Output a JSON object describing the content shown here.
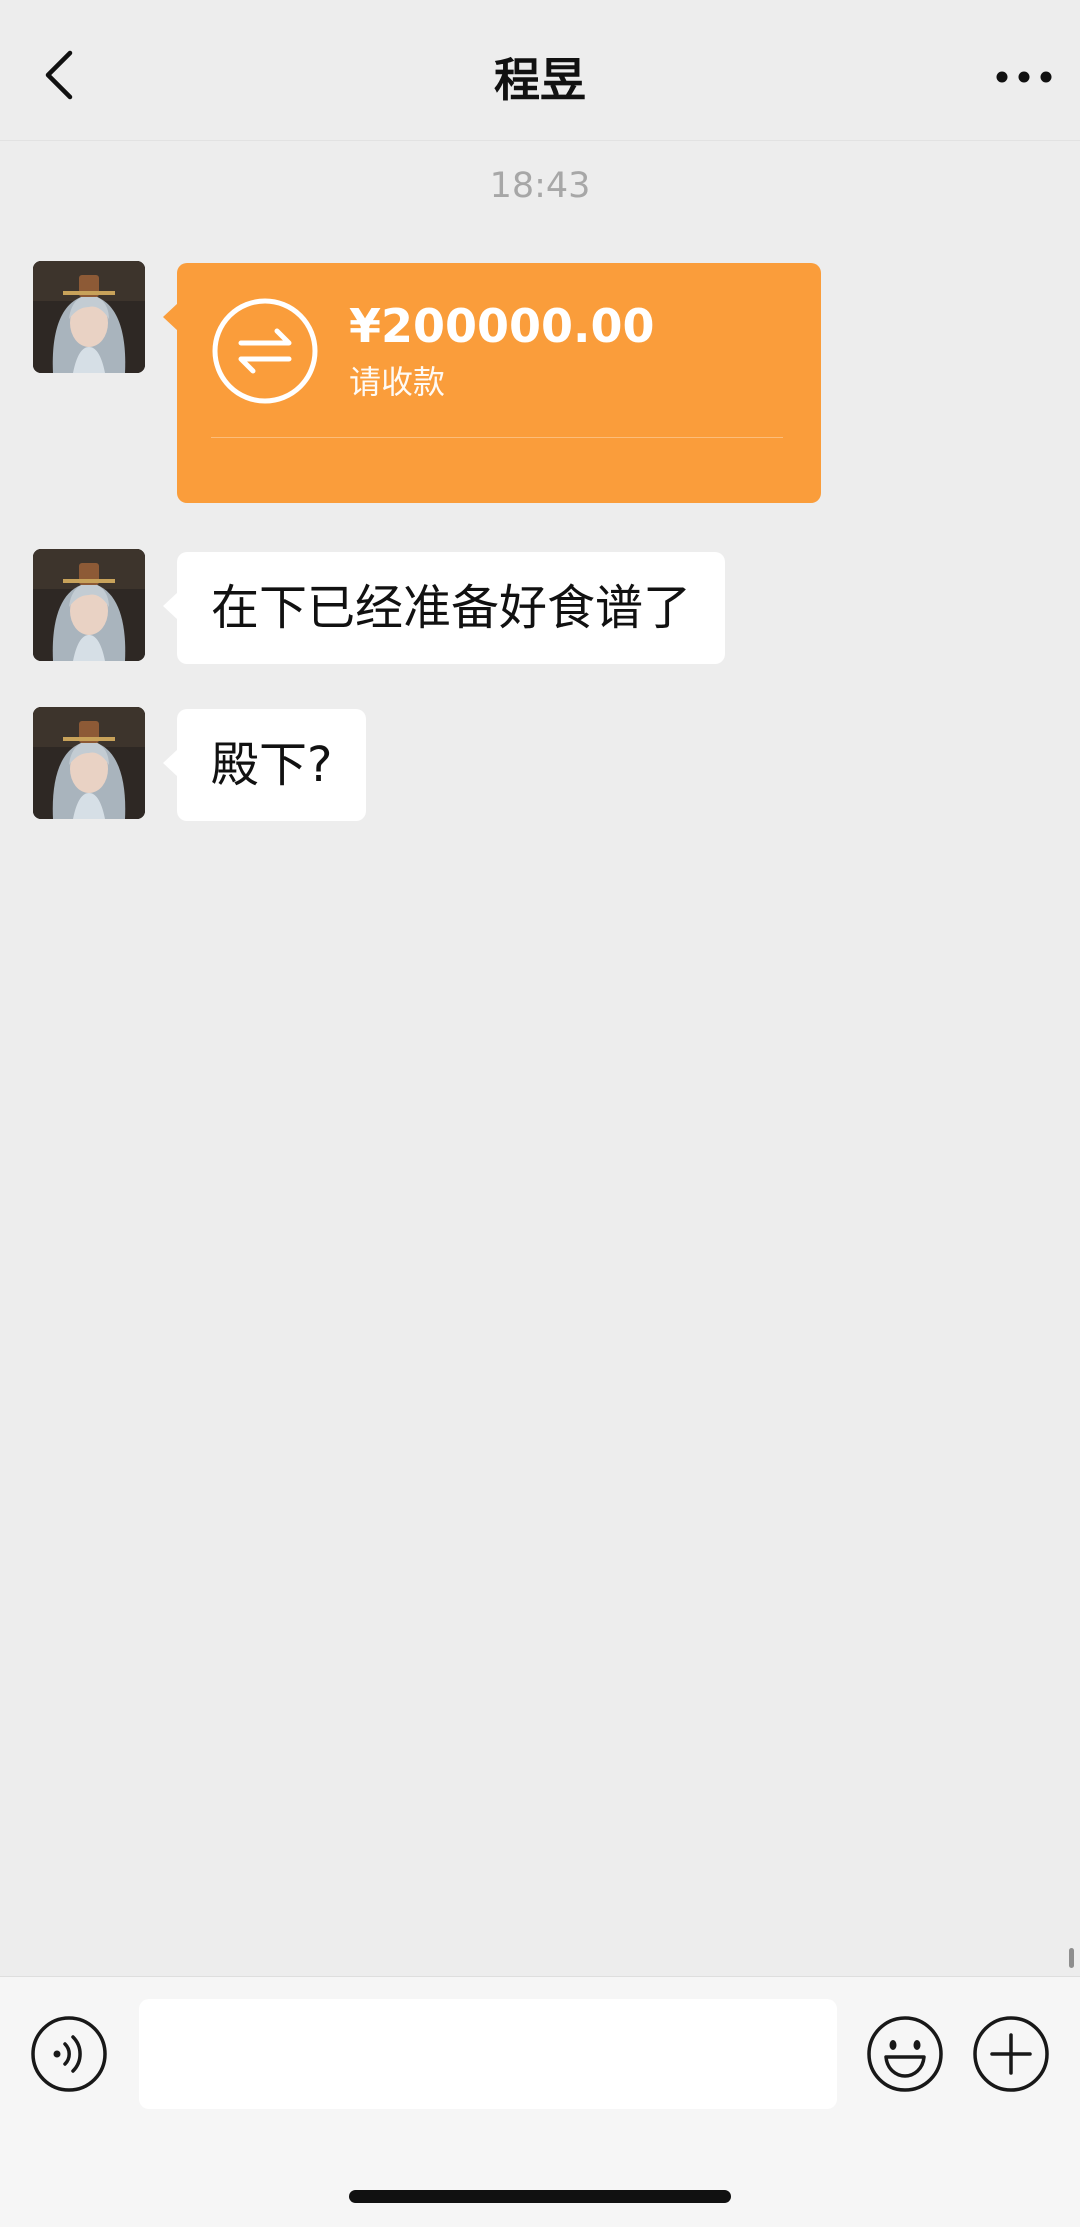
{
  "header": {
    "title": "程昱",
    "back_icon": "chevron-left-icon",
    "more_icon": "more-horizontal-icon"
  },
  "timestamp": "18:43",
  "messages": [
    {
      "type": "transfer",
      "amount": "¥200000.00",
      "label": "请收款",
      "color": "#fa9d3b",
      "icon": "transfer-exchange-icon"
    },
    {
      "type": "text",
      "text": "在下已经准备好食谱了"
    },
    {
      "type": "text",
      "text": "殿下?"
    }
  ],
  "input_bar": {
    "voice_icon": "voice-icon",
    "input_value": "",
    "emoji_icon": "emoji-icon",
    "plus_icon": "plus-icon"
  }
}
